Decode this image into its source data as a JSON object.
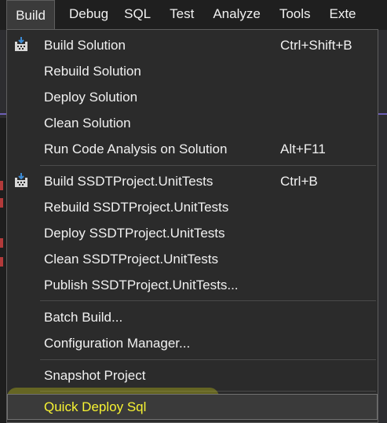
{
  "menubar": {
    "items": [
      {
        "label": "Build",
        "active": true
      },
      {
        "label": "Debug"
      },
      {
        "label": "SQL"
      },
      {
        "label": "Test"
      },
      {
        "label": "Analyze"
      },
      {
        "label": "Tools"
      },
      {
        "label": "Exte"
      }
    ]
  },
  "build_menu": {
    "groups": [
      [
        {
          "label": "Build Solution",
          "shortcut": "Ctrl+Shift+B",
          "icon": "build-icon"
        },
        {
          "label": "Rebuild Solution"
        },
        {
          "label": "Deploy Solution"
        },
        {
          "label": "Clean Solution"
        },
        {
          "label": "Run Code Analysis on Solution",
          "shortcut": "Alt+F11"
        }
      ],
      [
        {
          "label": "Build SSDTProject.UnitTests",
          "shortcut": "Ctrl+B",
          "icon": "build-icon"
        },
        {
          "label": "Rebuild SSDTProject.UnitTests"
        },
        {
          "label": "Deploy SSDTProject.UnitTests"
        },
        {
          "label": "Clean SSDTProject.UnitTests"
        },
        {
          "label": "Publish SSDTProject.UnitTests..."
        }
      ],
      [
        {
          "label": "Batch Build..."
        },
        {
          "label": "Configuration Manager..."
        }
      ],
      [
        {
          "label": "Snapshot Project"
        }
      ],
      [
        {
          "label": "Quick Deploy Sql",
          "highlighted": true
        }
      ]
    ]
  },
  "colors": {
    "menu_background": "#2b2b2b",
    "text": "#f1f1f1",
    "highlight_text": "#f7f332",
    "icon_accent": "#3b8bd6"
  }
}
